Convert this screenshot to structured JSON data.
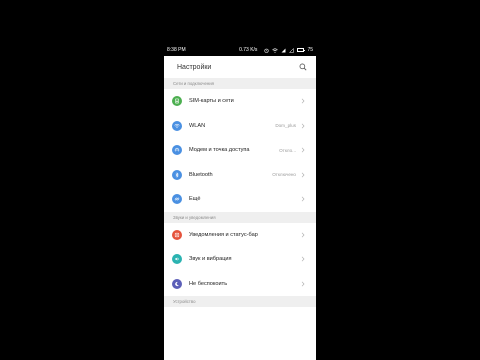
{
  "status_bar": {
    "time": "8:38 PM",
    "speed": "0.73 K/s",
    "battery": "75"
  },
  "header": {
    "title": "Настройки"
  },
  "sections": [
    {
      "title": "Сети и подключения",
      "items": [
        {
          "label": "SIM-карты и сети",
          "value": "",
          "icon": "sim-icon",
          "color": "#4caf50"
        },
        {
          "label": "WLAN",
          "value": "Dom_plus",
          "icon": "wifi-icon",
          "color": "#4a90e2"
        },
        {
          "label": "Модем и точка доступа",
          "value": "Откло...",
          "icon": "hotspot-icon",
          "color": "#4a90e2"
        },
        {
          "label": "Bluetooth",
          "value": "Отключено",
          "icon": "bluetooth-icon",
          "color": "#4a90e2"
        },
        {
          "label": "Ещё",
          "value": "",
          "icon": "link-icon",
          "color": "#4a90e2"
        }
      ]
    },
    {
      "title": "Звуки и уведомления",
      "items": [
        {
          "label": "Уведомления и статус-бар",
          "value": "",
          "icon": "notification-icon",
          "color": "#e5533c"
        },
        {
          "label": "Звук и вибрация",
          "value": "",
          "icon": "sound-icon",
          "color": "#2bb3b1"
        },
        {
          "label": "Не беспокоить",
          "value": "",
          "icon": "moon-icon",
          "color": "#5c5fb8"
        }
      ]
    },
    {
      "title": "Устройство",
      "items": []
    }
  ]
}
